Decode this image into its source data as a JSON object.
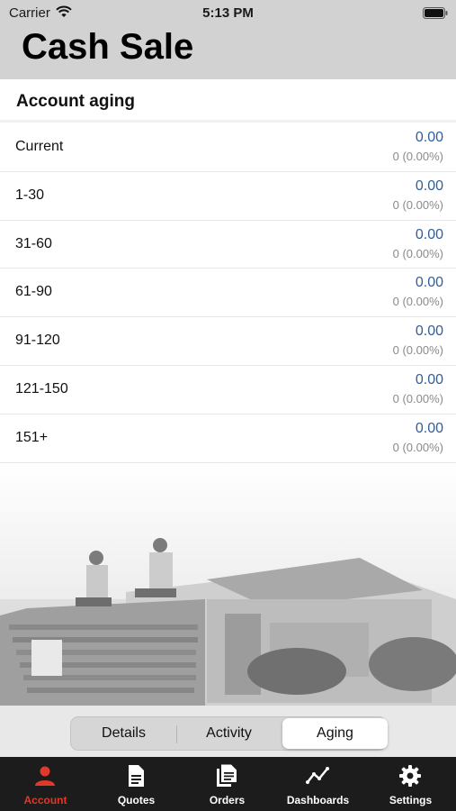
{
  "status_bar": {
    "carrier": "Carrier",
    "time": "5:13 PM"
  },
  "page": {
    "title": "Cash Sale"
  },
  "section": {
    "title": "Account aging"
  },
  "aging_rows": [
    {
      "label": "Current",
      "amount": "0.00",
      "detail": "0 (0.00%)"
    },
    {
      "label": "1-30",
      "amount": "0.00",
      "detail": "0 (0.00%)"
    },
    {
      "label": "31-60",
      "amount": "0.00",
      "detail": "0 (0.00%)"
    },
    {
      "label": "61-90",
      "amount": "0.00",
      "detail": "0 (0.00%)"
    },
    {
      "label": "91-120",
      "amount": "0.00",
      "detail": "0 (0.00%)"
    },
    {
      "label": "121-150",
      "amount": "0.00",
      "detail": "0 (0.00%)"
    },
    {
      "label": "151+",
      "amount": "0.00",
      "detail": "0 (0.00%)"
    }
  ],
  "segments": {
    "items": [
      "Details",
      "Activity",
      "Aging"
    ],
    "selected": "Aging"
  },
  "tabbar": {
    "items": [
      {
        "label": "Account",
        "icon": "person-icon"
      },
      {
        "label": "Quotes",
        "icon": "document-icon"
      },
      {
        "label": "Orders",
        "icon": "documents-icon"
      },
      {
        "label": "Dashboards",
        "icon": "line-chart-icon"
      },
      {
        "label": "Settings",
        "icon": "gear-icon"
      }
    ],
    "active": "Account"
  },
  "colors": {
    "accent": "#e0392b",
    "amount": "#2f5f9a",
    "header_bg": "#d2d2d2",
    "tabbar_bg": "#1c1c1c"
  }
}
